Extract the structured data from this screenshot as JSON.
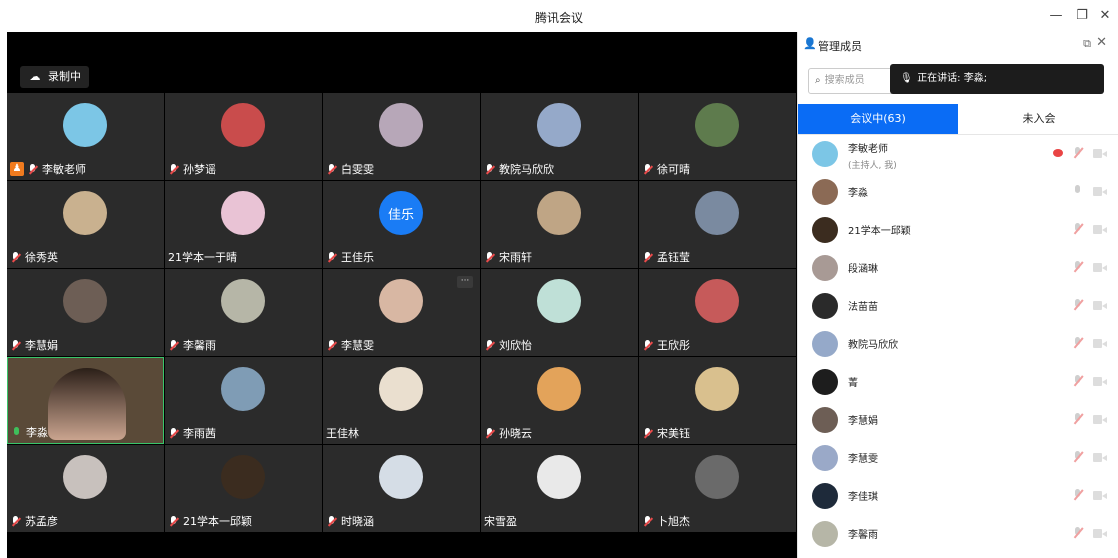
{
  "window": {
    "title": "腾讯会议"
  },
  "stage": {
    "recording_label": "录制中",
    "tiles": [
      {
        "name": "李敏老师",
        "host": true,
        "mic": "muted",
        "avatar_color": "#7cc6e6"
      },
      {
        "name": "孙梦谣",
        "mic": "muted",
        "avatar_color": "#c94c4c"
      },
      {
        "name": "白雯雯",
        "mic": "muted",
        "avatar_color": "#b7a7b8"
      },
      {
        "name": "教院马欣欣",
        "mic": "muted",
        "avatar_color": "#95a9c9"
      },
      {
        "name": "徐可晴",
        "mic": "muted",
        "avatar_color": "#5e7b4d"
      },
      {
        "name": "徐秀英",
        "mic": "muted",
        "avatar_color": "#c9b18f"
      },
      {
        "name": "21学本一于晴",
        "mic": "none",
        "avatar_color": "#e9c3d5"
      },
      {
        "name": "王佳乐",
        "mic": "muted",
        "avatar_color": "#1a7cf5",
        "avatar_text": "佳乐"
      },
      {
        "name": "宋雨轩",
        "mic": "muted",
        "avatar_color": "#bfa585"
      },
      {
        "name": "孟钰莹",
        "mic": "muted",
        "avatar_color": "#7a8aa0"
      },
      {
        "name": "李慧娟",
        "mic": "muted",
        "avatar_color": "#6d5e55"
      },
      {
        "name": "李馨雨",
        "mic": "muted",
        "avatar_color": "#b6b6a7"
      },
      {
        "name": "李慧雯",
        "mic": "muted",
        "avatar_color": "#d8b7a3"
      },
      {
        "name": "刘欣怡",
        "mic": "muted",
        "avatar_color": "#bfe0d7"
      },
      {
        "name": "王欣彤",
        "mic": "muted",
        "avatar_color": "#c65a5a"
      },
      {
        "name": "李淼",
        "mic": "on",
        "camera": true,
        "avatar_color": "#7a5a45"
      },
      {
        "name": "李雨茜",
        "mic": "muted",
        "avatar_color": "#7f9cb5"
      },
      {
        "name": "王佳林",
        "mic": "none",
        "avatar_color": "#eadfcf"
      },
      {
        "name": "孙晓云",
        "mic": "muted",
        "avatar_color": "#e3a35a"
      },
      {
        "name": "宋美钰",
        "mic": "muted",
        "avatar_color": "#d9c08e"
      },
      {
        "name": "苏孟彦",
        "mic": "muted",
        "avatar_color": "#c8c1bd"
      },
      {
        "name": "21学本一邱颖",
        "mic": "muted",
        "avatar_color": "#3b2c1f"
      },
      {
        "name": "时晓涵",
        "mic": "muted",
        "avatar_color": "#d5dde6"
      },
      {
        "name": "宋雪盈",
        "mic": "none",
        "avatar_color": "#e9e9e9"
      },
      {
        "name": "卜旭杰",
        "mic": "muted",
        "avatar_color": "#6a6a6a"
      }
    ]
  },
  "panel": {
    "title": "管理成员",
    "search_placeholder": "搜索成员",
    "speaking_label": "正在讲话: 李淼;",
    "tab_in_meeting": "会议中(63)",
    "tab_not_joined": "未入会",
    "participants": [
      {
        "name": "李敏老师",
        "sub": "(主持人, 我)",
        "avatar_color": "#7cc6e6",
        "recording": true,
        "mic": "muted"
      },
      {
        "name": "李淼",
        "avatar_color": "#8b6a55",
        "mic": "on"
      },
      {
        "name": "21学本一邱颖",
        "avatar_color": "#3b2c1f",
        "mic": "muted"
      },
      {
        "name": "段涵琳",
        "avatar_color": "#a89a95",
        "mic": "muted"
      },
      {
        "name": "法苗苗",
        "avatar_color": "#2a2a2a",
        "mic": "muted"
      },
      {
        "name": "教院马欣欣",
        "avatar_color": "#95a9c9",
        "mic": "muted"
      },
      {
        "name": "菁",
        "avatar_color": "#1d1d1d",
        "mic": "muted"
      },
      {
        "name": "李慧娟",
        "avatar_color": "#6d5e55",
        "mic": "muted"
      },
      {
        "name": "李慧雯",
        "avatar_color": "#9aa9c8",
        "mic": "muted"
      },
      {
        "name": "李佳琪",
        "avatar_color": "#1e2a3a",
        "mic": "muted"
      },
      {
        "name": "李馨雨",
        "avatar_color": "#b6b6a7",
        "mic": "muted"
      }
    ]
  }
}
